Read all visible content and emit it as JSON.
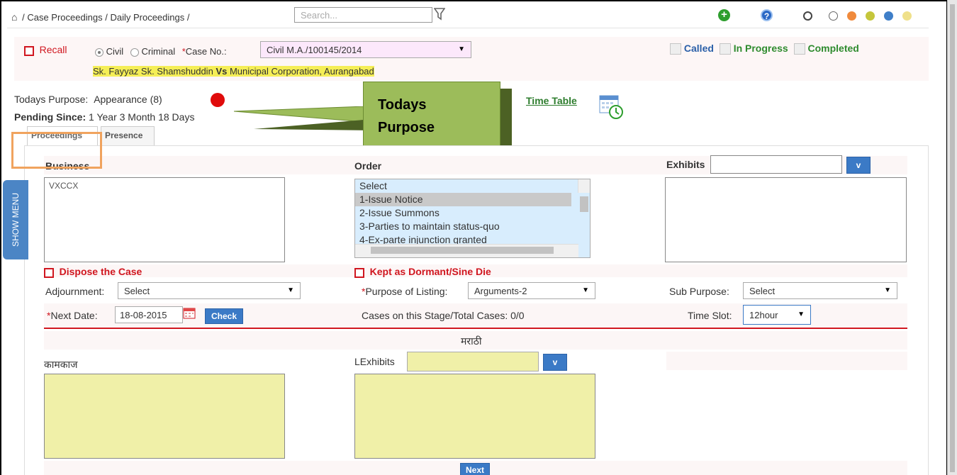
{
  "breadcrumb": {
    "home": "⌂",
    "items": [
      "Case Proceedings",
      "Daily Proceedings"
    ],
    "sep": "/"
  },
  "search": {
    "placeholder": "Search..."
  },
  "header_icons": {
    "add": "+",
    "help": "?"
  },
  "theme_dots": [
    "#ffffff",
    "#ffffff",
    "#f08a3c",
    "#c5c63b",
    "#3f7fc8",
    "#efe08a"
  ],
  "recall": {
    "label": "Recall"
  },
  "case_type": {
    "civil": "Civil",
    "criminal": "Criminal",
    "selected": "civil"
  },
  "case_no": {
    "label": "Case No.:",
    "value": "Civil M.A./100145/2014"
  },
  "parties": {
    "petitioner": "Sk. Fayyaz Sk. Shamshuddin",
    "vs": "Vs",
    "respondent": "Municipal Corporation, Aurangabad"
  },
  "status": {
    "called": "Called",
    "in_progress": "In Progress",
    "completed": "Completed"
  },
  "todays_purpose": {
    "label": "Todays Purpose:",
    "value": "Appearance (8)"
  },
  "pending_since": {
    "label": "Pending Since:",
    "value": "1 Year 3 Month 18 Days"
  },
  "time_table": {
    "label": "Time Table"
  },
  "callout": {
    "line1": "Todays",
    "line2": "Purpose"
  },
  "tabs": {
    "proceedings": "Proceedings",
    "presence": "Presence"
  },
  "business": {
    "label": "Business",
    "value": "VXCCX"
  },
  "orders": {
    "label": "Order",
    "options": [
      "Select",
      "1-Issue Notice",
      "2-Issue Summons",
      "3-Parties to maintain status-quo",
      "4-Ex-parte injunction granted"
    ],
    "selected": "1-Issue Notice"
  },
  "exhibits": {
    "label": "Exhibits",
    "button": "v"
  },
  "show_menu": "SHOW MENU",
  "dispose": {
    "label": "Dispose the Case"
  },
  "dormant": {
    "label": "Kept as Dormant/Sine Die"
  },
  "adjournment": {
    "label": "Adjournment:",
    "value": "Select"
  },
  "purpose_listing": {
    "label": "Purpose of Listing:",
    "value": "Arguments-2"
  },
  "sub_purpose": {
    "label": "Sub Purpose:",
    "value": "Select"
  },
  "next_date": {
    "label": "Next Date:",
    "value": "18-08-2015",
    "check": "Check"
  },
  "cases_stage": {
    "label": "Cases on this Stage/Total Cases:",
    "value": "0/0"
  },
  "time_slot": {
    "label": "Time Slot:",
    "value": "12hour"
  },
  "marathi": {
    "heading": "मराठी",
    "kamkaj": "कामकाज",
    "lexhibits": "LExhibits",
    "lexhibits_button": "v"
  },
  "next_button": "Next",
  "colors": {
    "accent_red": "#d0161f",
    "accent_blue": "#3b7ac6",
    "callout_green": "#9cbc5a"
  }
}
